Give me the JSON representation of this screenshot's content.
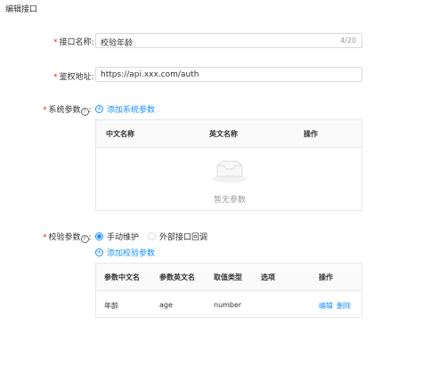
{
  "page": {
    "title": "编辑接口"
  },
  "form": {
    "name": {
      "label": "接口名称:",
      "value": "校验年龄",
      "count": "4/20"
    },
    "auth": {
      "label": "鉴权地址:",
      "value": "https://api.xxx.com/auth"
    },
    "system_params": {
      "label": "系统参数",
      "add_label": "添加系统参数",
      "columns": [
        "中文名称",
        "英文名称",
        "操作"
      ],
      "empty_text": "暂无参数"
    },
    "verify_params": {
      "label": "校验参数",
      "radio_options": [
        "手动维护",
        "外部接口回调"
      ],
      "selected": "手动维护",
      "add_label": "添加校验参数",
      "columns": [
        "参数中文名",
        "参数英文名",
        "取值类型",
        "选项",
        "操作"
      ],
      "rows": [
        {
          "cn": "年龄",
          "en": "age",
          "type": "number",
          "options": "",
          "edit": "编辑",
          "delete": "删除"
        }
      ]
    }
  },
  "colors": {
    "primary": "#1890ff",
    "required": "#f5222d",
    "border": "#e8e8e8"
  }
}
